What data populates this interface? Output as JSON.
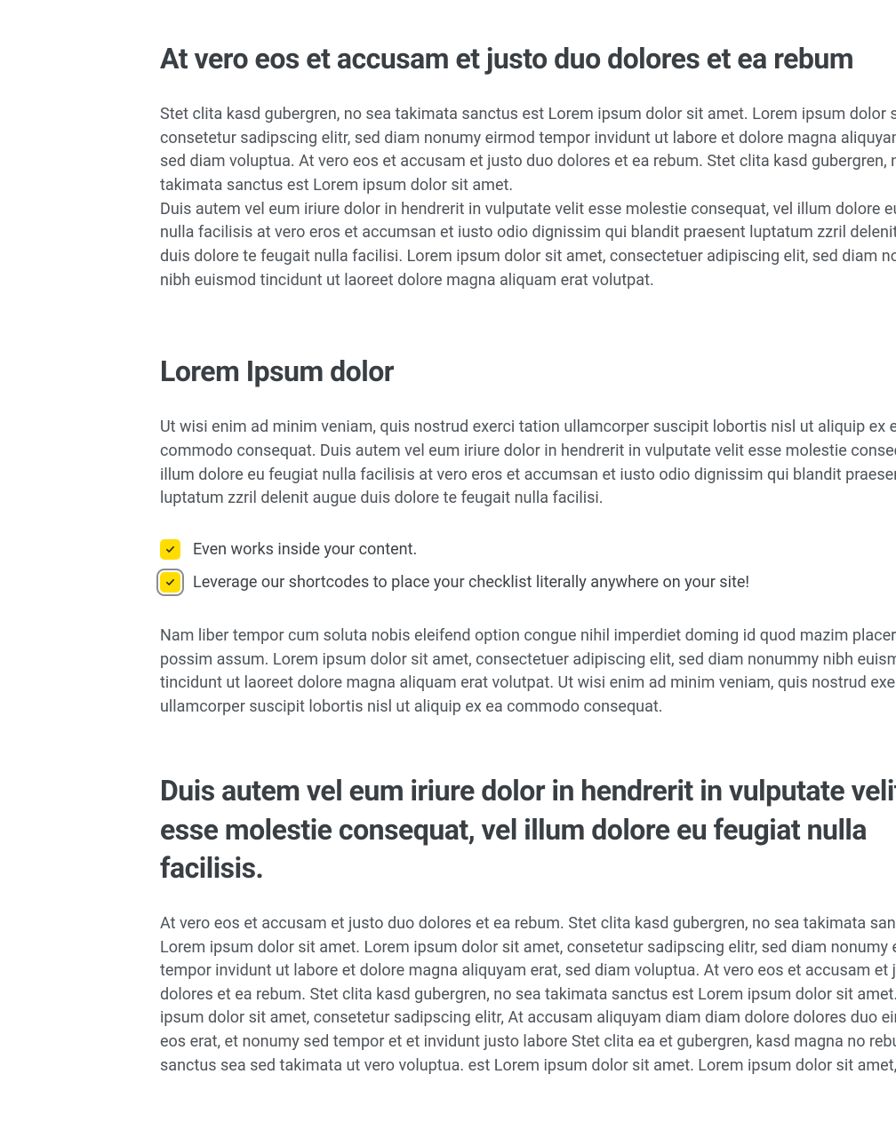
{
  "section1": {
    "heading": "At vero eos et accusam et justo duo dolores et ea rebum",
    "para1": "Stet clita kasd gubergren, no sea takimata sanctus est Lorem ipsum dolor sit amet. Lorem ipsum dolor sit amet, consetetur sadipscing elitr, sed diam nonumy eirmod tempor invidunt ut labore et dolore magna aliquyam erat, sed diam voluptua. At vero eos et accusam et justo duo dolores et ea rebum. Stet clita kasd gubergren, no sea takimata sanctus est Lorem ipsum dolor sit amet.",
    "para2": "Duis autem vel eum iriure dolor in hendrerit in vulputate velit esse molestie consequat, vel illum dolore eu feugiat nulla facilisis at vero eros et accumsan et iusto odio dignissim qui blandit praesent luptatum zzril delenit augue duis dolore te feugait nulla facilisi. Lorem ipsum dolor sit amet, consectetuer adipiscing elit, sed diam nonummy nibh euismod tincidunt ut laoreet dolore magna aliquam erat volutpat."
  },
  "section2": {
    "heading": "Lorem Ipsum dolor",
    "para1": "Ut wisi enim ad minim veniam, quis nostrud exerci tation ullamcorper suscipit lobortis nisl ut aliquip ex ea commodo consequat. Duis autem vel eum iriure dolor in hendrerit in vulputate velit esse molestie consequat, vel illum dolore eu feugiat nulla facilisis at vero eros et accumsan et iusto odio dignissim qui blandit praesent luptatum zzril delenit augue duis dolore te feugait nulla facilisi.",
    "checklist": [
      "Even works inside your content.",
      "Leverage our shortcodes to place your checklist literally anywhere on your site!"
    ],
    "para2": "Nam liber tempor cum soluta nobis eleifend option congue nihil imperdiet doming id quod mazim placerat facer possim assum. Lorem ipsum dolor sit amet, consectetuer adipiscing elit, sed diam nonummy nibh euismod tincidunt ut laoreet dolore magna aliquam erat volutpat. Ut wisi enim ad minim veniam, quis nostrud exerci tation ullamcorper suscipit lobortis nisl ut aliquip ex ea commodo consequat."
  },
  "section3": {
    "heading": "Duis autem vel eum iriure dolor in hendrerit in vulputate velit esse molestie consequat, vel illum dolore eu feugiat nulla facilisis.",
    "para1": "At vero eos et accusam et justo duo dolores et ea rebum. Stet clita kasd gubergren, no sea takimata sanctus est Lorem ipsum dolor sit amet. Lorem ipsum dolor sit amet, consetetur sadipscing elitr, sed diam nonumy eirmod tempor invidunt ut labore et dolore magna aliquyam erat, sed diam voluptua. At vero eos et accusam et justo duo dolores et ea rebum. Stet clita kasd gubergren, no sea takimata sanctus est Lorem ipsum dolor sit amet. Lorem ipsum dolor sit amet, consetetur sadipscing elitr, At accusam aliquyam diam diam dolore dolores duo eirmod eos erat, et nonumy sed tempor et et invidunt justo labore Stet clita ea et gubergren, kasd magna no rebum. sanctus sea sed takimata ut vero voluptua. est Lorem ipsum dolor sit amet. Lorem ipsum dolor sit amet,"
  }
}
